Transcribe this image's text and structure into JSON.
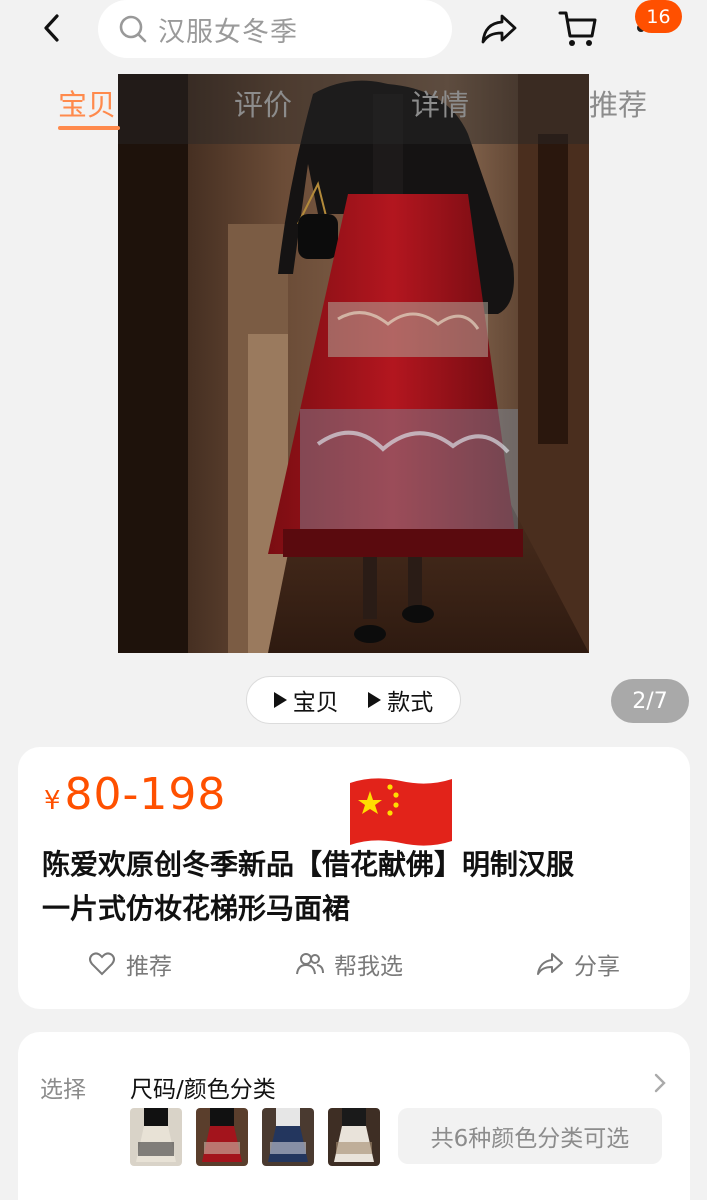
{
  "search": {
    "query": "汉服女冬季"
  },
  "cart": {
    "badge_count": "16"
  },
  "tabs": [
    {
      "label": "宝贝",
      "active": true
    },
    {
      "label": "评价",
      "active": false
    },
    {
      "label": "详情",
      "active": false
    },
    {
      "label": "推荐",
      "active": false
    }
  ],
  "media": {
    "item_label": "宝贝",
    "style_label": "款式",
    "counter": "2/7"
  },
  "product": {
    "currency": "¥",
    "price": "80-198",
    "title_line1": "陈爱欢原创冬季新品【借花献佛】明制汉服",
    "title_line2": "一片式仿妆花梯形马面裙",
    "flag_icon": "china-flag-emoji"
  },
  "actions": {
    "recommend": "推荐",
    "help_choose": "帮我选",
    "share": "分享"
  },
  "select": {
    "label": "选择",
    "value": "尺码/颜色分类",
    "variants_text": "共6种颜色分类可选"
  },
  "colors": {
    "accent": "#ff5000",
    "tab_active": "#ff8a4c",
    "skirt_red": "#a3141c"
  }
}
